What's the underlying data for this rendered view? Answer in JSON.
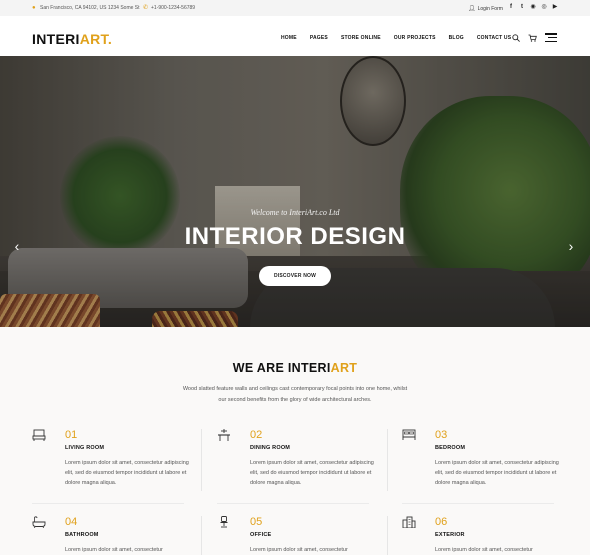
{
  "topbar": {
    "address": "San Francisco, CA 94102, US 1234 Some St",
    "phone": "+1-900-1234-56789",
    "login": "Login Form",
    "socials": [
      "facebook-icon",
      "twitter-icon",
      "github-icon",
      "instagram-icon",
      "youtube-icon"
    ]
  },
  "header": {
    "logo_main": "INTERI",
    "logo_accent": "ART.",
    "nav": [
      "HOME",
      "PAGES",
      "STORE ONLINE",
      "OUR PROJECTS",
      "BLOG",
      "CONTACT US"
    ]
  },
  "hero": {
    "tagline": "Welcome to InteriArt.co Ltd",
    "title": "INTERIOR DESIGN",
    "cta": "DISCOVER NOW"
  },
  "about": {
    "heading_main": "WE ARE INTERI",
    "heading_accent": "ART",
    "intro": "Wood slatted feature walls and ceilings cast contemporary focal points into one home, whilst our second benefits from the glory of wide architectural arches.",
    "features": [
      {
        "num": "01",
        "name": "LIVING ROOM",
        "icon": "tv-stand-icon",
        "desc": "Lorem ipsum dolor sit amet, consectetur adipiscing elit, sed do eiusmod tempor incididunt ut labore et dolore magna aliqua."
      },
      {
        "num": "02",
        "name": "DINING ROOM",
        "icon": "dining-table-icon",
        "desc": "Lorem ipsum dolor sit amet, consectetur adipiscing elit, sed do eiusmod tempor incididunt ut labore et dolore magna aliqua."
      },
      {
        "num": "03",
        "name": "BEDROOM",
        "icon": "bed-icon",
        "desc": "Lorem ipsum dolor sit amet, consectetur adipiscing elit, sed do eiusmod tempor incididunt ut labore et dolore magna aliqua."
      },
      {
        "num": "04",
        "name": "BATHROOM",
        "icon": "bathtub-icon",
        "desc": "Lorem ipsum dolor sit amet, consectetur"
      },
      {
        "num": "05",
        "name": "OFFICE",
        "icon": "office-chair-icon",
        "desc": "Lorem ipsum dolor sit amet, consectetur"
      },
      {
        "num": "06",
        "name": "EXTERIOR",
        "icon": "building-icon",
        "desc": "Lorem ipsum dolor sit amet, consectetur"
      }
    ]
  },
  "colors": {
    "accent": "#e0a11b",
    "text": "#111111",
    "muted": "#555555"
  }
}
